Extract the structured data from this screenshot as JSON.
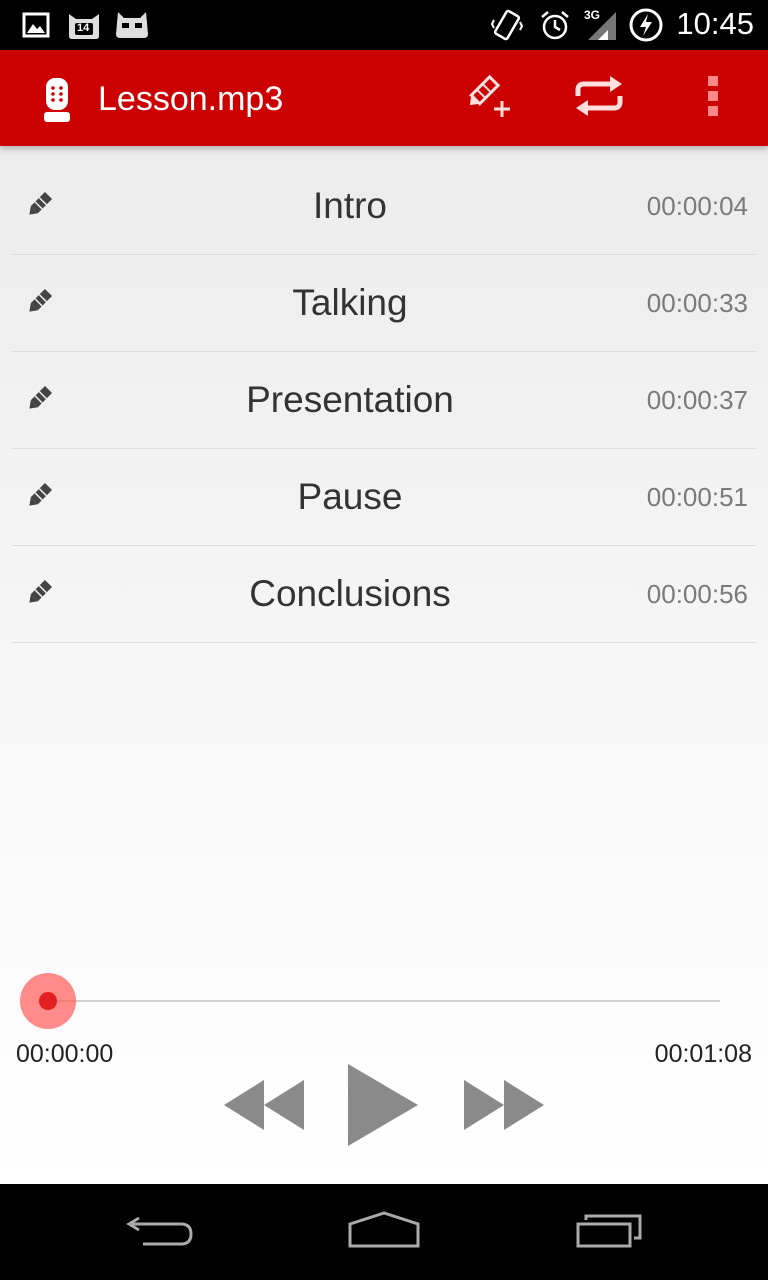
{
  "status_bar": {
    "time": "10:45",
    "network": "3G",
    "notification_badge": "14",
    "icons": [
      "image-notification-icon",
      "cat-notification-icon",
      "cyanogen-icon",
      "vibrate-icon",
      "alarm-icon",
      "signal-icon",
      "battery-charging-icon"
    ]
  },
  "app_bar": {
    "title": "Lesson.mp3",
    "icons": [
      "recorder-icon",
      "add-marker-icon",
      "repeat-icon",
      "overflow-menu-icon"
    ],
    "accent_color": "#cc0000"
  },
  "markers": [
    {
      "name": "Intro",
      "time": "00:00:04"
    },
    {
      "name": "Talking",
      "time": "00:00:33"
    },
    {
      "name": "Presentation",
      "time": "00:00:37"
    },
    {
      "name": "Pause",
      "time": "00:00:51"
    },
    {
      "name": "Conclusions",
      "time": "00:00:56"
    }
  ],
  "player": {
    "current_time": "00:00:00",
    "total_time": "00:01:08",
    "progress": 0,
    "controls": [
      "rewind-icon",
      "play-icon",
      "fast-forward-icon"
    ]
  },
  "nav_bar": {
    "icons": [
      "back-icon",
      "home-icon",
      "recents-icon"
    ]
  }
}
